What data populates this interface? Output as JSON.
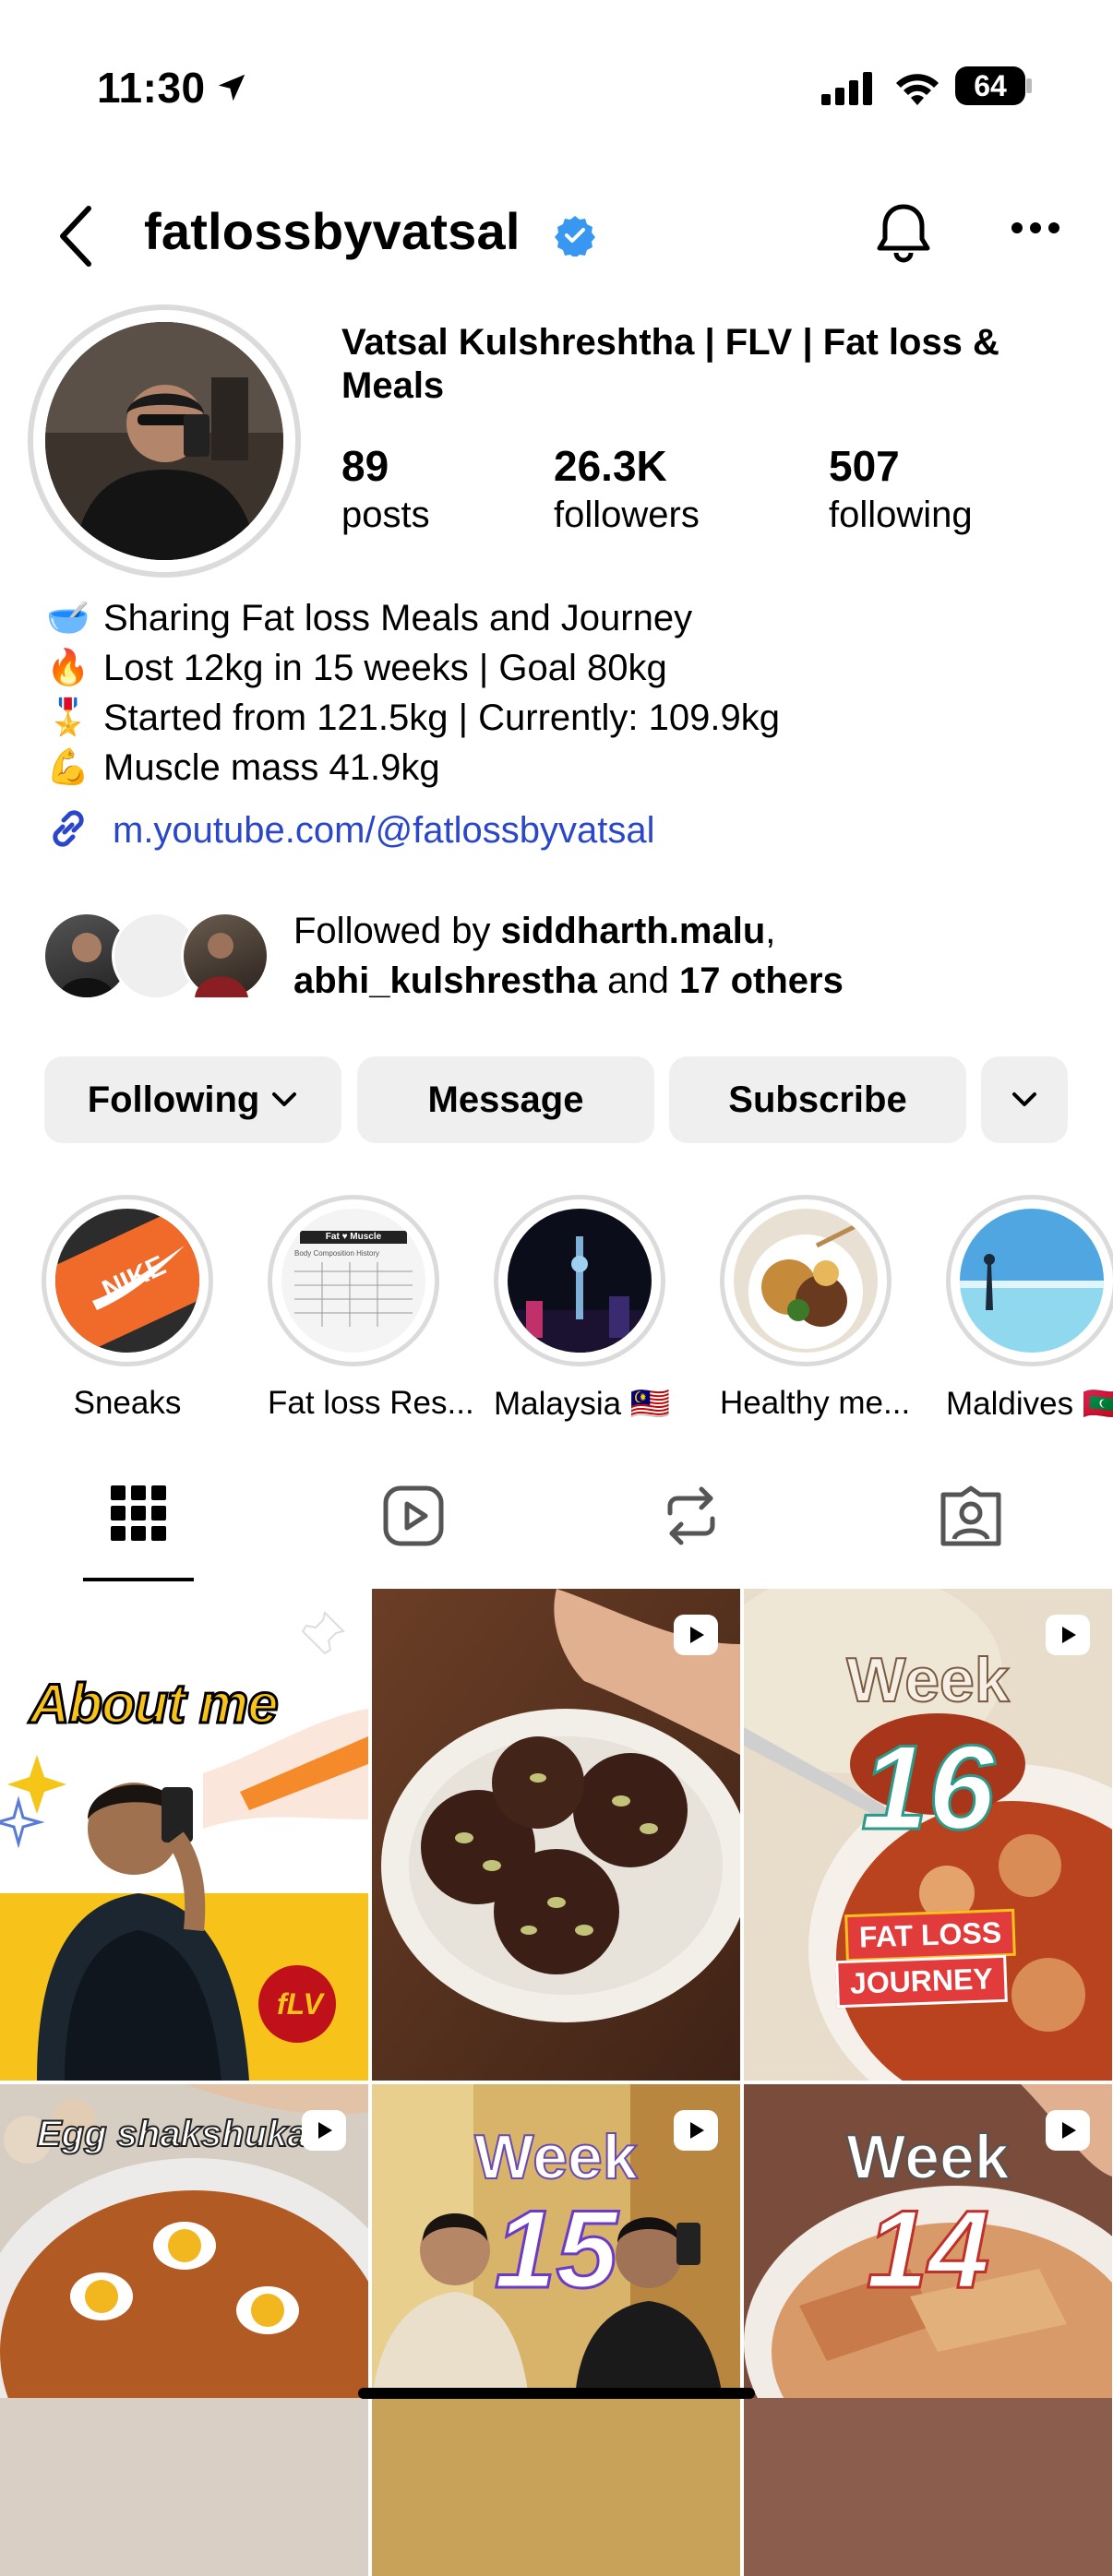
{
  "status_bar": {
    "time": "11:30",
    "battery": "64"
  },
  "header": {
    "username": "fatlossbyvatsal"
  },
  "profile": {
    "full_name": "Vatsal Kulshreshtha | FLV | Fat loss & Meals",
    "stats": [
      {
        "value": "89",
        "label": "posts"
      },
      {
        "value": "26.3K",
        "label": "followers"
      },
      {
        "value": "507",
        "label": "following"
      }
    ],
    "bio": [
      {
        "emoji": "🥣",
        "text": "Sharing Fat loss Meals and Journey"
      },
      {
        "emoji": "🔥",
        "text": "Lost 12kg in 15 weeks | Goal 80kg"
      },
      {
        "emoji": "🎖️",
        "text": "Started from 121.5kg | Currently: 109.9kg"
      },
      {
        "emoji": "💪",
        "text": "Muscle mass 41.9kg"
      }
    ],
    "link": "m.youtube.com/@fatlossbyvatsal",
    "followed_by": {
      "prefix": "Followed by ",
      "user1": "siddharth.malu",
      "sep": ",",
      "user2": "abhi_kulshrestha",
      "and": " and ",
      "others": "17 others"
    }
  },
  "actions": {
    "following": "Following",
    "message": "Message",
    "subscribe": "Subscribe"
  },
  "highlights": [
    {
      "label": "Sneaks"
    },
    {
      "label": "Fat loss Res..."
    },
    {
      "label": "Malaysia 🇲🇾"
    },
    {
      "label": "Healthy me..."
    },
    {
      "label": "Maldives 🇲🇻"
    }
  ],
  "highlight_thumb_text": {
    "fat_loss_header": "Fat ♥ Muscle",
    "fat_loss_sub": "Body Composition History"
  },
  "grid": [
    {
      "caption": "About me",
      "logo": "fLV",
      "reel": false
    },
    {
      "caption": "",
      "reel": true
    },
    {
      "caption": "Week",
      "big": "16",
      "tag1": "FAT LOSS",
      "tag2": "JOURNEY",
      "reel": true
    },
    {
      "caption": "Egg shakshuka",
      "reel": true
    },
    {
      "caption": "Week",
      "big": "15",
      "reel": true
    },
    {
      "caption": "Week",
      "big": "14",
      "reel": true
    }
  ],
  "colors": {
    "link": "#2a46c9",
    "verified": "#3897f0",
    "button_bg": "#efefef"
  }
}
